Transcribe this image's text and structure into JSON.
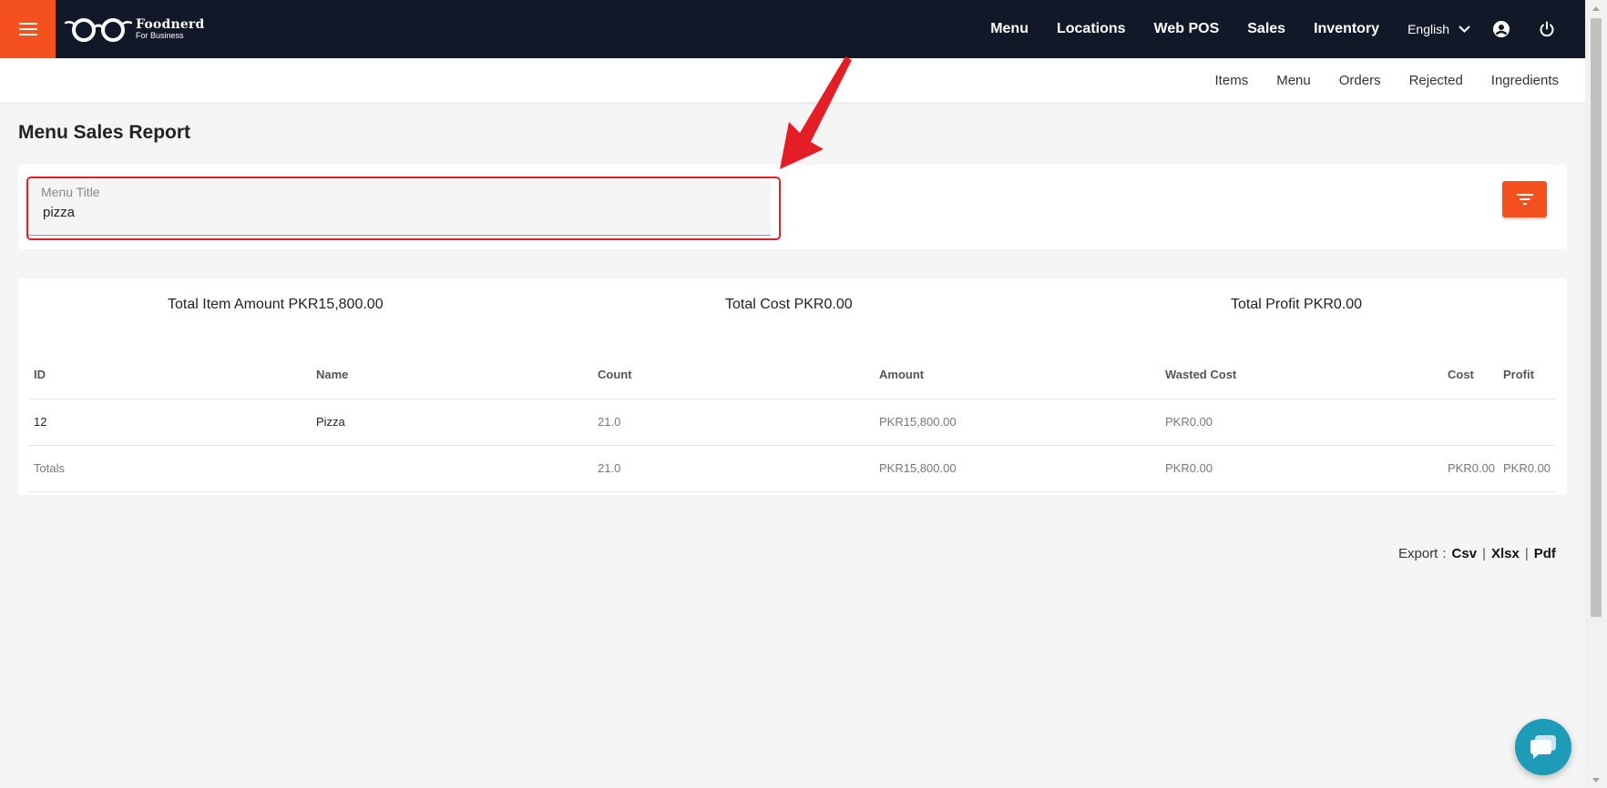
{
  "app": {
    "brand_name": "Foodnerd",
    "brand_sub": "For Business"
  },
  "topnav": {
    "items": [
      "Menu",
      "Locations",
      "Web POS",
      "Sales",
      "Inventory"
    ],
    "language": "English"
  },
  "subnav": {
    "items": [
      "Items",
      "Menu",
      "Orders",
      "Rejected",
      "Ingredients"
    ]
  },
  "page": {
    "title": "Menu Sales Report"
  },
  "filter": {
    "label": "Menu Title",
    "value": "pizza"
  },
  "summary": {
    "total_item_amount": "Total Item Amount PKR15,800.00",
    "total_cost": "Total Cost PKR0.00",
    "total_profit": "Total Profit PKR0.00"
  },
  "table": {
    "headers": [
      "ID",
      "Name",
      "Count",
      "Amount",
      "Wasted Cost",
      "Cost",
      "Profit"
    ],
    "rows": [
      {
        "id": "12",
        "name": "Pizza",
        "count": "21.0",
        "amount": "PKR15,800.00",
        "wasted_cost": "PKR0.00",
        "cost": "",
        "profit": ""
      }
    ],
    "totals": {
      "label": "Totals",
      "name": "",
      "count": "21.0",
      "amount": "PKR15,800.00",
      "wasted_cost": "PKR0.00",
      "cost": "PKR0.00",
      "profit": "PKR0.00"
    }
  },
  "export": {
    "label": "Export",
    "colon": ":",
    "csv": "Csv",
    "xlsx": "Xlsx",
    "pdf": "Pdf",
    "separator": "|"
  },
  "colors": {
    "navbar": "#111827",
    "accent": "#f4511e",
    "annotation": "#e41e26",
    "chat": "#1e9bb8"
  }
}
